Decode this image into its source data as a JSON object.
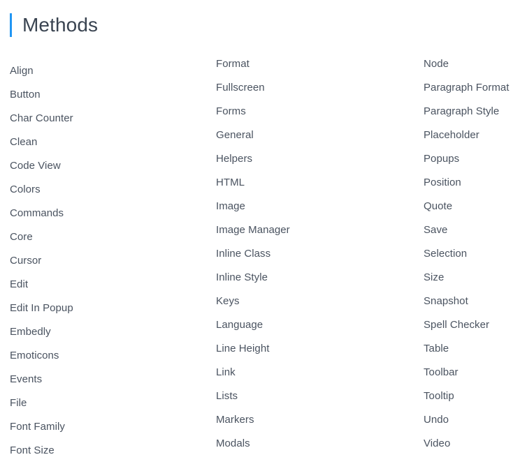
{
  "heading": {
    "title": "Methods",
    "accent_color": "#2196F3"
  },
  "theme": {
    "background": "#FFFFFF",
    "heading_color": "#3A4451",
    "link_color": "#4A5360"
  },
  "columns": [
    {
      "name": "column-1",
      "items": [
        "Align",
        "Button",
        "Char Counter",
        "Clean",
        "Code View",
        "Colors",
        "Commands",
        "Core",
        "Cursor",
        "Edit",
        "Edit In Popup",
        "Embedly",
        "Emoticons",
        "Events",
        "File",
        "Font Family",
        "Font Size"
      ]
    },
    {
      "name": "column-2",
      "items": [
        "Format",
        "Fullscreen",
        "Forms",
        "General",
        "Helpers",
        "HTML",
        "Image",
        "Image Manager",
        "Inline Class",
        "Inline Style",
        "Keys",
        "Language",
        "Line Height",
        "Link",
        "Lists",
        "Markers",
        "Modals"
      ]
    },
    {
      "name": "column-3",
      "items": [
        "Node",
        "Paragraph Format",
        "Paragraph Style",
        "Placeholder",
        "Popups",
        "Position",
        "Quote",
        "Save",
        "Selection",
        "Size",
        "Snapshot",
        "Spell Checker",
        "Table",
        "Toolbar",
        "Tooltip",
        "Undo",
        "Video"
      ]
    }
  ]
}
